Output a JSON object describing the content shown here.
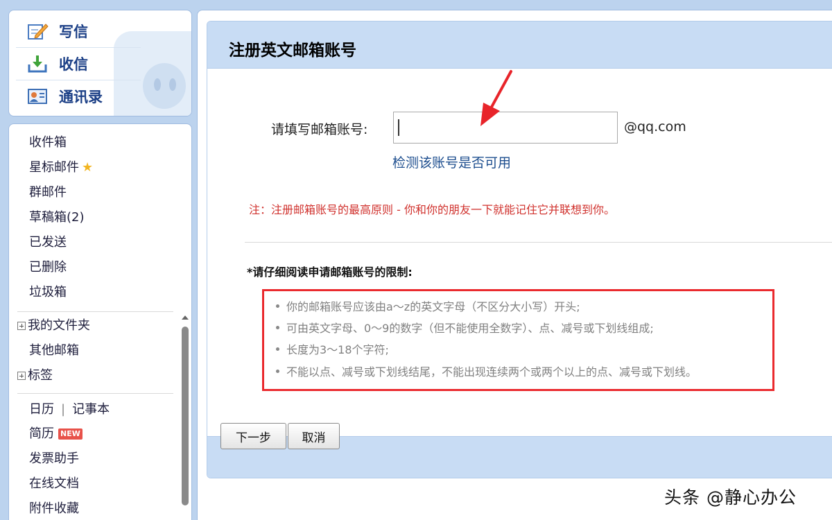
{
  "quick_actions": [
    {
      "label": "写信",
      "icon": "compose-icon"
    },
    {
      "label": "收信",
      "icon": "inbox-download-icon"
    },
    {
      "label": "通讯录",
      "icon": "contacts-icon"
    }
  ],
  "sidebar": {
    "folders": [
      {
        "label": "收件箱"
      },
      {
        "label": "星标邮件",
        "icon": "star-icon"
      },
      {
        "label": "群邮件"
      },
      {
        "label": "草稿箱(2)"
      },
      {
        "label": "已发送"
      },
      {
        "label": "已删除"
      },
      {
        "label": "垃圾箱"
      }
    ],
    "my_folders": "我的文件夹",
    "other_mailbox": "其他邮箱",
    "tags": "标签",
    "calendar": "日历",
    "notes": "记事本",
    "resume": "简历",
    "resume_badge": "NEW",
    "invoice": "发票助手",
    "online_docs": "在线文档",
    "attachments": "附件收藏"
  },
  "main": {
    "title": "注册英文邮箱账号",
    "field_label": "请填写邮箱账号:",
    "field_value": "",
    "domain_suffix": "@qq.com",
    "check_link": "检测该账号是否可用",
    "note": "注：注册邮箱账号的最高原则 - 你和你的朋友一下就能记住它并联想到你。",
    "rules_title": "*请仔细阅读申请邮箱账号的限制:",
    "rules": [
      "你的邮箱账号应该由a～z的英文字母（不区分大小写）开头;",
      "可由英文字母、0～9的数字（但不能使用全数字）、点、减号或下划线组成;",
      "长度为3～18个字符;",
      "不能以点、减号或下划线结尾，不能出现连续两个或两个以上的点、减号或下划线。"
    ],
    "next_button": "下一步",
    "cancel_button": "取消"
  },
  "watermark": "头条 @静心办公",
  "colors": {
    "background": "#bcd3ee",
    "header_bar": "#c8dcf4",
    "nav_text": "#1b3f86",
    "link": "#1c4d8e",
    "note_red": "#d0312d",
    "highlight_box": "#ea2a2e",
    "arrow": "#e8242a"
  }
}
